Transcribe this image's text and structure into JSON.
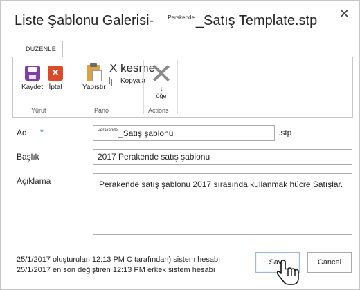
{
  "dialog": {
    "title_prefix": "Liste Şablonu Galerisi-",
    "title_superscript": "Perakende",
    "title_suffix": "_Satış Template.stp",
    "close_label": "✕"
  },
  "ribbon": {
    "tab_label": "DÜZENLE",
    "groups": [
      {
        "label": "Yürüt",
        "buttons": [
          {
            "label": "Kaydet",
            "icon": "save-icon"
          },
          {
            "label": "İptal",
            "icon": "cancel-icon"
          }
        ]
      },
      {
        "label": "Pano",
        "paste_label": "Yapıştır",
        "cut_label": "X kesme",
        "copy_label": "Kopyala"
      },
      {
        "label": "Actions",
        "delete_label_line1": "t",
        "delete_label_line2": "öğe"
      }
    ]
  },
  "form": {
    "name_label": "Ad",
    "required_marker": "*",
    "name_value_superscript": "Perakende",
    "name_value": "_Satış şablonu",
    "name_extension": ".stp",
    "title_label": "Başlık",
    "title_value": "2017 Perakende satış şablonu",
    "description_label": "Açıklama",
    "description_value": "Perakende satış şablonu 2017 sırasında kullanmak hücre Satışlar."
  },
  "footer": {
    "created_text": "25/1/2017 oluşturulan 12:13 PM C tarafından) sistem hesabı",
    "modified_text": "25/1/2017 en son değiştiren 12:13 PM erkek sistem hesabı",
    "save_label": "Save",
    "cancel_label": "Cancel"
  },
  "colors": {
    "save_icon": "#7d3fa4",
    "cancel_icon": "#d94b2b",
    "paste_icon": "#d9a34a",
    "required_marker": "#2a6ebb",
    "border": "#ababab"
  }
}
